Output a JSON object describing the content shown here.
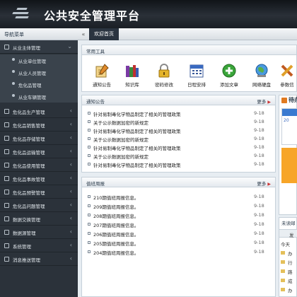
{
  "header": {
    "title": "公共安全管理平台"
  },
  "topbar": {
    "nav_caption": "导航菜单",
    "collapse": "«",
    "home_tab": "欢迎首页"
  },
  "sidebar": {
    "groups": [
      {
        "label": "从业主体管理",
        "open": true,
        "children": [
          "从业单位管理",
          "从业人员管理",
          "危化品管理",
          "从业车辆管理"
        ]
      },
      {
        "label": "危化品生产管理"
      },
      {
        "label": "危化品销售管理"
      },
      {
        "label": "危化品存储管理"
      },
      {
        "label": "危化品运输管理"
      },
      {
        "label": "危化品使用管理"
      },
      {
        "label": "危化品事故管理"
      },
      {
        "label": "危化品预警管理"
      },
      {
        "label": "危化品问题管理"
      },
      {
        "label": "数据交换管理"
      },
      {
        "label": "数据源管理"
      },
      {
        "label": "系统管理"
      },
      {
        "label": "消息推送管理"
      }
    ]
  },
  "tools": {
    "title": "常用工具",
    "items": [
      {
        "label": "通知公告",
        "icon": "notice-pencil-icon"
      },
      {
        "label": "知识库",
        "icon": "books-icon"
      },
      {
        "label": "密码修改",
        "icon": "padlock-icon"
      },
      {
        "label": "日程安排",
        "icon": "calendar-icon"
      },
      {
        "label": "添加文章",
        "icon": "add-plus-icon"
      },
      {
        "label": "网络硬盘",
        "icon": "globe-disk-icon"
      },
      {
        "label": "参数信",
        "icon": "settings-tools-icon"
      }
    ]
  },
  "notices": {
    "title": "通知公告",
    "more": "更多",
    "rows": [
      {
        "text": "针对易制毒化学物品制定了相关的管理政策",
        "date": "9-18"
      },
      {
        "text": "关于公示数据加密的新规定",
        "date": "9-18"
      },
      {
        "text": "针对易制毒化学物品制定了相关的管理政策",
        "date": "9-18"
      },
      {
        "text": "关于公示数据加密的新规定",
        "date": "9-18"
      },
      {
        "text": "针对易制毒化学物品制定了相关的管理政策",
        "date": "9-18"
      },
      {
        "text": "关于公示数据加密的新规定",
        "date": "9-18"
      },
      {
        "text": "针对易制毒化学物品制定了相关的管理政策",
        "date": "9-18"
      }
    ]
  },
  "weekly": {
    "title": "值班周报",
    "more": "更多",
    "rows": [
      {
        "text": "210期值班周报信息。",
        "date": "9-18"
      },
      {
        "text": "209期值班周报信息。",
        "date": "9-18"
      },
      {
        "text": "208期值班周报信息。",
        "date": "9-18"
      },
      {
        "text": "207期值班周报信息。",
        "date": "9-18"
      },
      {
        "text": "206期值班周报信息。",
        "date": "9-18"
      },
      {
        "text": "205期值班周报信息。",
        "date": "9-18"
      },
      {
        "text": "204期值班周报信息。",
        "date": "9-18"
      }
    ]
  },
  "side_panel": {
    "top_title": "待办",
    "top_sub": "20",
    "bottom_title": "未读邮",
    "col": "发",
    "today": "今天",
    "items": [
      "办",
      "行",
      "路",
      "成",
      "办"
    ]
  },
  "colors": {
    "header": "#1c2127",
    "sidebar": "#2b323a",
    "accent": "#2a3440"
  }
}
